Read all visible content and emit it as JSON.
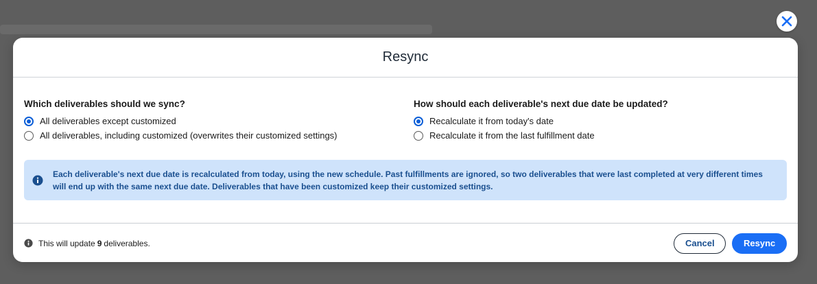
{
  "modal": {
    "title": "Resync",
    "close_icon": "close-icon"
  },
  "sync_scope": {
    "question": "Which deliverables should we sync?",
    "options": [
      {
        "label": "All deliverables except customized",
        "selected": true
      },
      {
        "label": "All deliverables, including customized (overwrites their customized settings)",
        "selected": false
      }
    ]
  },
  "due_date": {
    "question": "How should each deliverable's next due date be updated?",
    "options": [
      {
        "label": "Recalculate it from today's date",
        "selected": true
      },
      {
        "label": "Recalculate it from the last fulfillment date",
        "selected": false
      }
    ]
  },
  "info": {
    "icon": "info-icon",
    "text": "Each deliverable's next due date is recalculated from today, using the new schedule. Past fulfillments are ignored, so two deliverables that were last completed at very different times will end up with the same next due date. Deliverables that have been customized keep their customized settings."
  },
  "footer": {
    "note_prefix": "This will update",
    "note_count": "9",
    "note_suffix": "deliverables.",
    "cancel_label": "Cancel",
    "resync_label": "Resync"
  },
  "colors": {
    "accent": "#0b5ed7",
    "primary_button": "#1a6ef5",
    "info_background": "#cfe3fb",
    "info_text": "#1a4f8f",
    "overlay": "#5e5e5e"
  }
}
